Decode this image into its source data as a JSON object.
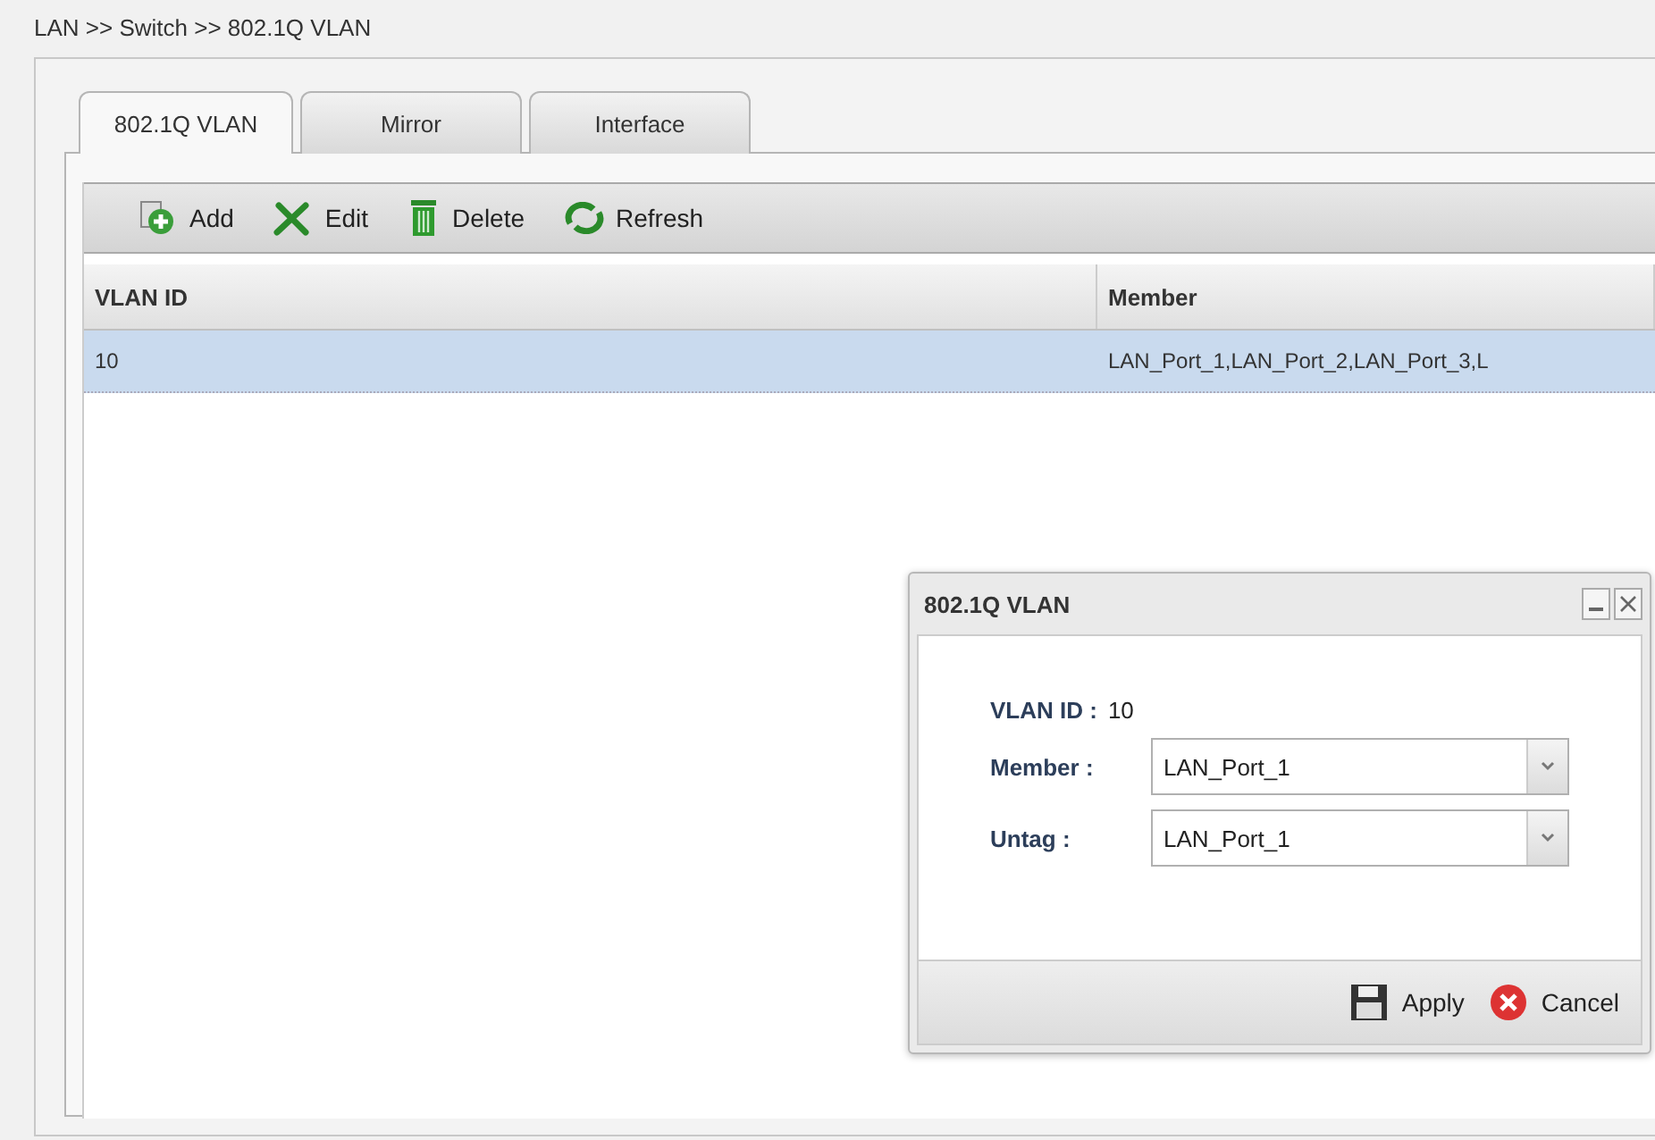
{
  "breadcrumb": "LAN >> Switch >> 802.1Q VLAN",
  "tabs": [
    {
      "label": "802.1Q VLAN",
      "selected": true
    },
    {
      "label": "Mirror",
      "selected": false
    },
    {
      "label": "Interface",
      "selected": false
    }
  ],
  "toolbar": [
    {
      "kind": "add",
      "label": "Add"
    },
    {
      "kind": "edit",
      "label": "Edit"
    },
    {
      "kind": "delete",
      "label": "Delete"
    },
    {
      "kind": "refresh",
      "label": "Refresh"
    }
  ],
  "table": {
    "columns": [
      "VLAN ID",
      "Member"
    ],
    "rows": [
      {
        "cells": [
          "10",
          "LAN_Port_1,LAN_Port_2,LAN_Port_3,L"
        ],
        "selected": true
      }
    ]
  },
  "dialog": {
    "title": "802.1Q VLAN",
    "vlan_id_label": "VLAN ID :",
    "vlan_id": "10",
    "fields": [
      {
        "label": "Member :",
        "value": "LAN_Port_1"
      },
      {
        "label": "Untag :",
        "value": "LAN_Port_1"
      }
    ],
    "buttons": [
      {
        "kind": "apply",
        "label": "Apply"
      },
      {
        "kind": "cancel",
        "label": "Cancel"
      }
    ]
  }
}
